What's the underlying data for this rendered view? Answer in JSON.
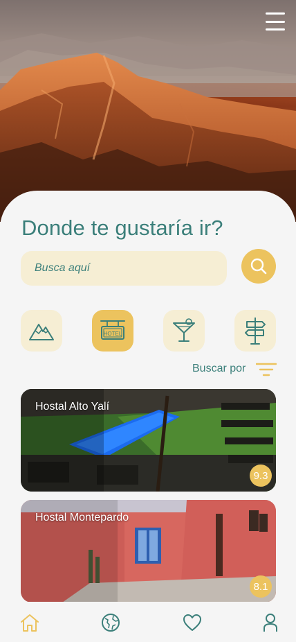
{
  "header": {
    "menu_icon": "hamburger-menu-icon"
  },
  "main": {
    "title": "Donde te gustaría ir?",
    "search": {
      "placeholder": "Busca aquí",
      "value": "",
      "button_icon": "search-icon"
    },
    "categories": [
      {
        "icon": "mountain-icon",
        "active": false
      },
      {
        "icon": "hotel-sign-icon",
        "label": "HOTEL",
        "active": true
      },
      {
        "icon": "cocktail-icon",
        "active": false
      },
      {
        "icon": "signpost-icon",
        "active": false
      }
    ],
    "filter": {
      "label": "Buscar por",
      "icon": "filter-lines-icon"
    },
    "listings": [
      {
        "name": "Hostal Alto Yalí",
        "rating": "9.3"
      },
      {
        "name": "Hostal Montepardo",
        "rating": "8.1"
      }
    ]
  },
  "bottom_nav": {
    "items": [
      {
        "icon": "home-icon",
        "active": true
      },
      {
        "icon": "globe-icon",
        "active": false
      },
      {
        "icon": "heart-icon",
        "active": false
      },
      {
        "icon": "user-icon",
        "active": false
      }
    ]
  },
  "colors": {
    "accent_teal": "#3b7f7a",
    "accent_yellow": "#ecc35e",
    "field_bg": "#f6eed4",
    "page_bg": "#f5f5f5"
  }
}
